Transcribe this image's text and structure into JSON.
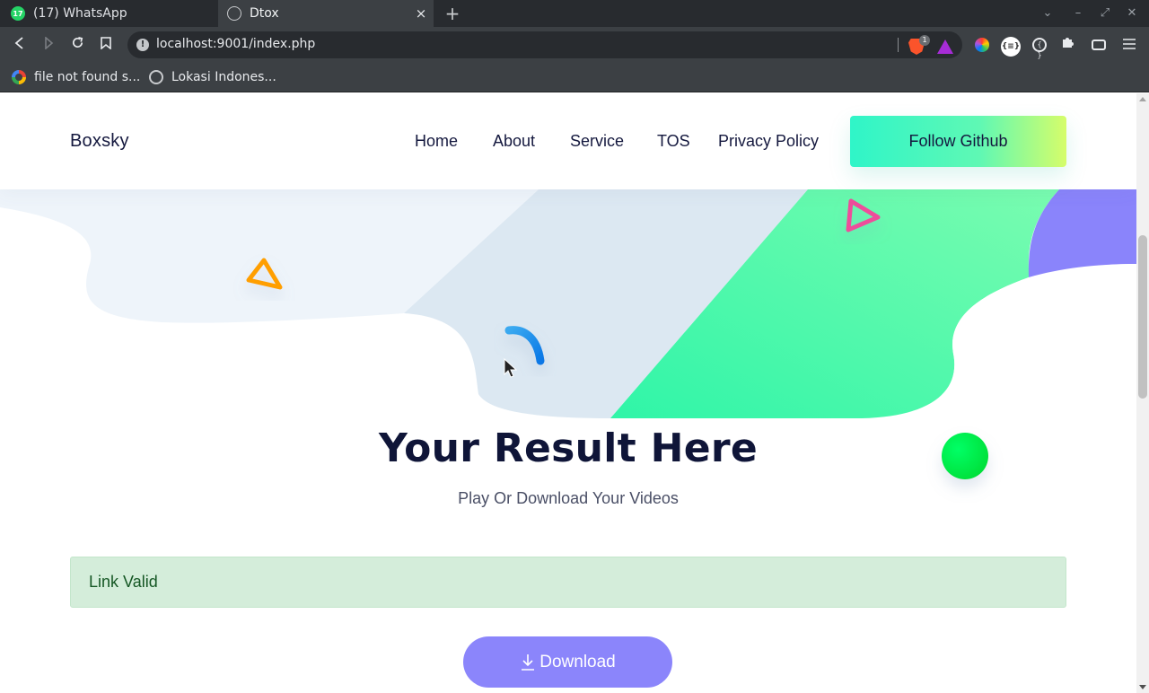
{
  "browser": {
    "tabs": [
      {
        "label": "(17) WhatsApp",
        "badge": "17",
        "active": false
      },
      {
        "label": "Dtox",
        "active": true
      }
    ],
    "new_tab": "+",
    "close_tab": "×",
    "url": "localhost:9001/index.php",
    "brave_badge": "1",
    "json_ext_label": "{≡}",
    "dev_ext_label": "{ }",
    "bookmarks": [
      {
        "label": "file not found s..."
      },
      {
        "label": "Lokasi Indones..."
      }
    ],
    "window_controls": {
      "minimize": "–",
      "restore": "⤢",
      "close": "✕",
      "dropdown": "⌄"
    },
    "colors": {
      "tab_bar": "#282b2f",
      "toolbar": "#3c4044"
    }
  },
  "site": {
    "brand": "Boxsky",
    "nav": [
      {
        "label": "Home"
      },
      {
        "label": "About"
      },
      {
        "label": "Service"
      },
      {
        "label": "TOS"
      },
      {
        "label": "Privacy Policy"
      }
    ],
    "cta": "Follow Github",
    "title": "Your Result Here",
    "subtitle": "Play Or Download Your Videos",
    "alert": "Link Valid",
    "download": "Download",
    "colors": {
      "accent_gradient_start": "#2ff5c8",
      "accent_gradient_end": "#d6fd6a",
      "download_button": "#8b85fb",
      "alert_bg": "#d4edda",
      "alert_text": "#155724",
      "title_text": "#0f1538"
    }
  }
}
